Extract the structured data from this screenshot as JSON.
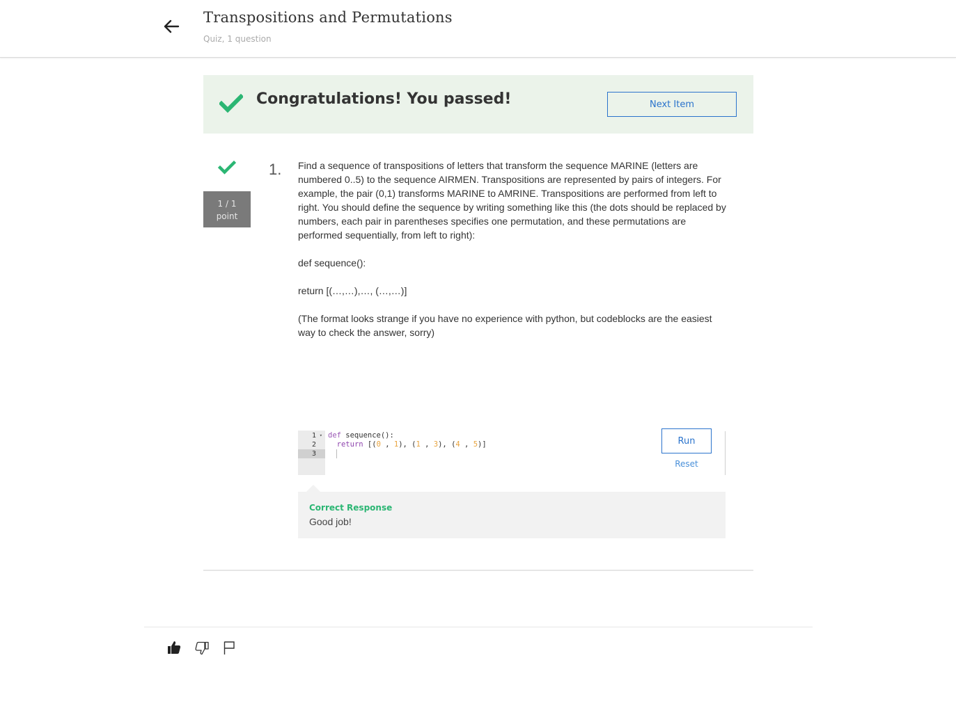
{
  "header": {
    "title": "Transpositions and Permutations",
    "subtitle": "Quiz, 1 question"
  },
  "banner": {
    "message": "Congratulations! You passed!",
    "next_label": "Next Item"
  },
  "question": {
    "number": "1.",
    "score": "1 / 1",
    "score_unit": "point",
    "paragraphs": [
      "Find a sequence of transpositions of letters that transform the sequence MARINE (letters are numbered 0..5) to the sequence AIRMEN. Transpositions are represented by pairs of integers. For example, the pair (0,1) transforms MARINE to AMRINE. Transpositions are performed from left to right. You should define the sequence by writing something like this (the dots should be replaced by numbers, each pair in parentheses specifies one permutation, and these permutations are performed sequentially, from left to right):",
      "def sequence():",
      "return [(…,…),…, (…,…)]",
      "(The format looks strange if you have no experience with python, but codeblocks are the easiest way to check the answer, sorry)"
    ]
  },
  "editor": {
    "line_numbers": [
      "1",
      "2",
      "3"
    ],
    "run_label": "Run",
    "reset_label": "Reset"
  },
  "feedback": {
    "title": "Correct Response",
    "text": "Good job!"
  },
  "icons": {
    "back": "arrow-left-icon",
    "passed": "checkmark-icon",
    "like": "thumbs-up-icon",
    "dislike": "thumbs-down-icon",
    "flag": "flag-icon"
  },
  "colors": {
    "success": "#2bb673",
    "link": "#2a73cc",
    "banner_bg": "#ebf3ea",
    "points_bg": "#7a7a7a"
  }
}
